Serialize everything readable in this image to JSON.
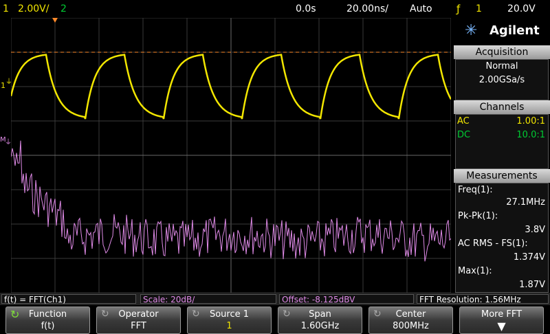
{
  "topbar": {
    "ch1_num": "1",
    "ch1_scale": "2.00V/",
    "ch2_num": "2",
    "time_delay": "0.0s",
    "time_scale": "20.00ns/",
    "trigger_mode": "Auto",
    "trigger_source": "1",
    "trigger_level": "20.0V"
  },
  "brand": "Agilent",
  "acquisition": {
    "title": "Acquisition",
    "mode": "Normal",
    "rate": "2.00GSa/s"
  },
  "channels": {
    "title": "Channels",
    "rows": [
      {
        "coupling": "AC",
        "probe": "1.00:1"
      },
      {
        "coupling": "DC",
        "probe": "10.0:1"
      }
    ]
  },
  "measurements": {
    "title": "Measurements",
    "items": [
      {
        "label": "Freq(1):",
        "value": "27.1MHz"
      },
      {
        "label": "Pk-Pk(1):",
        "value": "3.8V"
      },
      {
        "label": "AC RMS - FS(1):",
        "value": "1.374V"
      },
      {
        "label": "Max(1):",
        "value": "1.87V"
      }
    ]
  },
  "markers": {
    "ch1": "1",
    "math": "M"
  },
  "status": {
    "function": "f(t) = FFT(Ch1)",
    "scale": "Scale: 20dB/",
    "offset": "Offset: -8.125dBV",
    "resolution": "FFT Resolution: 1.56MHz"
  },
  "softkeys": [
    {
      "label": "Function",
      "value": "f(t)"
    },
    {
      "label": "Operator",
      "value": "FFT"
    },
    {
      "label": "Source 1",
      "value": "1"
    },
    {
      "label": "Span",
      "value": "1.60GHz"
    },
    {
      "label": "Center",
      "value": "800MHz"
    },
    {
      "label": "More FFT",
      "value": ""
    }
  ],
  "colors": {
    "ch1": "#f2e600",
    "ch2": "#00cc33",
    "math": "#e08be8",
    "trigger": "#ff8a2a"
  }
}
